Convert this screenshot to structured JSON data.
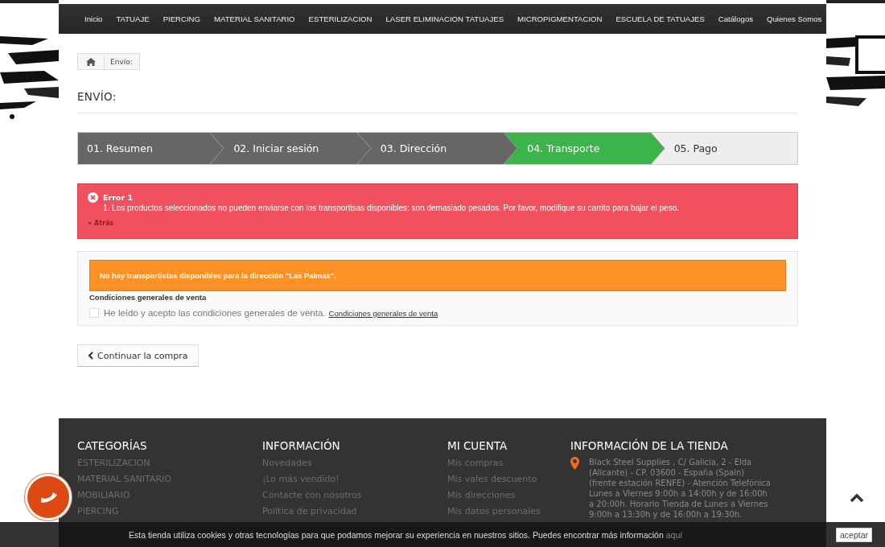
{
  "nav": {
    "items": [
      "Inicio",
      "TATUAJE",
      "PIERCING",
      "MATERIAL SANITARIO",
      "ESTERILIZACION",
      "LASER ELIMINACION TATUAJES",
      "MICROPIGMENTACION",
      "ESCUELA DE TATUAJES",
      "Catálogos",
      "Quienes Somos"
    ]
  },
  "breadcrumb": {
    "current": "Envío:"
  },
  "page_title": "ENVÍO:",
  "steps": [
    {
      "label": "01. Resumen",
      "completed": true,
      "selected": false
    },
    {
      "label": "02. Iniciar sesión",
      "completed": true,
      "selected": false
    },
    {
      "label": "03. Dirección",
      "completed": true,
      "selected": false
    },
    {
      "label": "04. Transporte",
      "completed": false,
      "selected": true
    },
    {
      "label": "05. Pago",
      "completed": false,
      "selected": false
    }
  ],
  "error": {
    "title": "Error 1",
    "message": "1. Los productos seleccionados no pueden enviarse con los transportisas disponibles: son demasiado pesados. Por favor, modifique su carrito para bajar el peso.",
    "back_link": "« Atrás"
  },
  "carrier_warning": "No hay transportistas disponibles para la dirección \"Las Palmas\".",
  "terms": {
    "heading": "Condiciones generales de venta",
    "checked": false,
    "label": "He leído y acepto las condiciones generales de venta.",
    "link": "Condiciones generales de venta"
  },
  "continue_button": "Continuar la compra",
  "footer": {
    "columns": [
      {
        "title": "CATEGORÍAS",
        "items": [
          "ESTERILIZACION",
          "MATERIAL SANITARIO",
          "MOBILIARIO",
          "PIERCING"
        ]
      },
      {
        "title": "INFORMACIÓN",
        "items": [
          "Novedades",
          "¡Lo más vendido!",
          "Contacte con nosotros",
          "Política de privacidad"
        ]
      },
      {
        "title": "MI CUENTA",
        "items": [
          "Mis compras",
          "Mis vales descuento",
          "Mis direcciones",
          "Mis datos personales"
        ]
      }
    ],
    "store": {
      "title": "INFORMACIÓN DE LA TIENDA",
      "address": "Black Steel Supplies , C/ Galicia, 2 - Elda (Alicante) - CP. 03600 - España (Spain) (frente estación RENFE) - Atención Telefónica Lunes a Viernes 9:00h a 14:00h y de 16:00h a 20:00h. Horario Tienda de Lunes a Viernes 9:00h a 13:30h y de 16:00h a 19:30h."
    }
  },
  "cookie_bar": {
    "text": "Esta tienda utiliza cookies y otras tecnologías para que podamos mejorar su experiencia en nuestros sitios. Puedes encontrar más información",
    "link": "aquí",
    "button": "aceptar"
  }
}
